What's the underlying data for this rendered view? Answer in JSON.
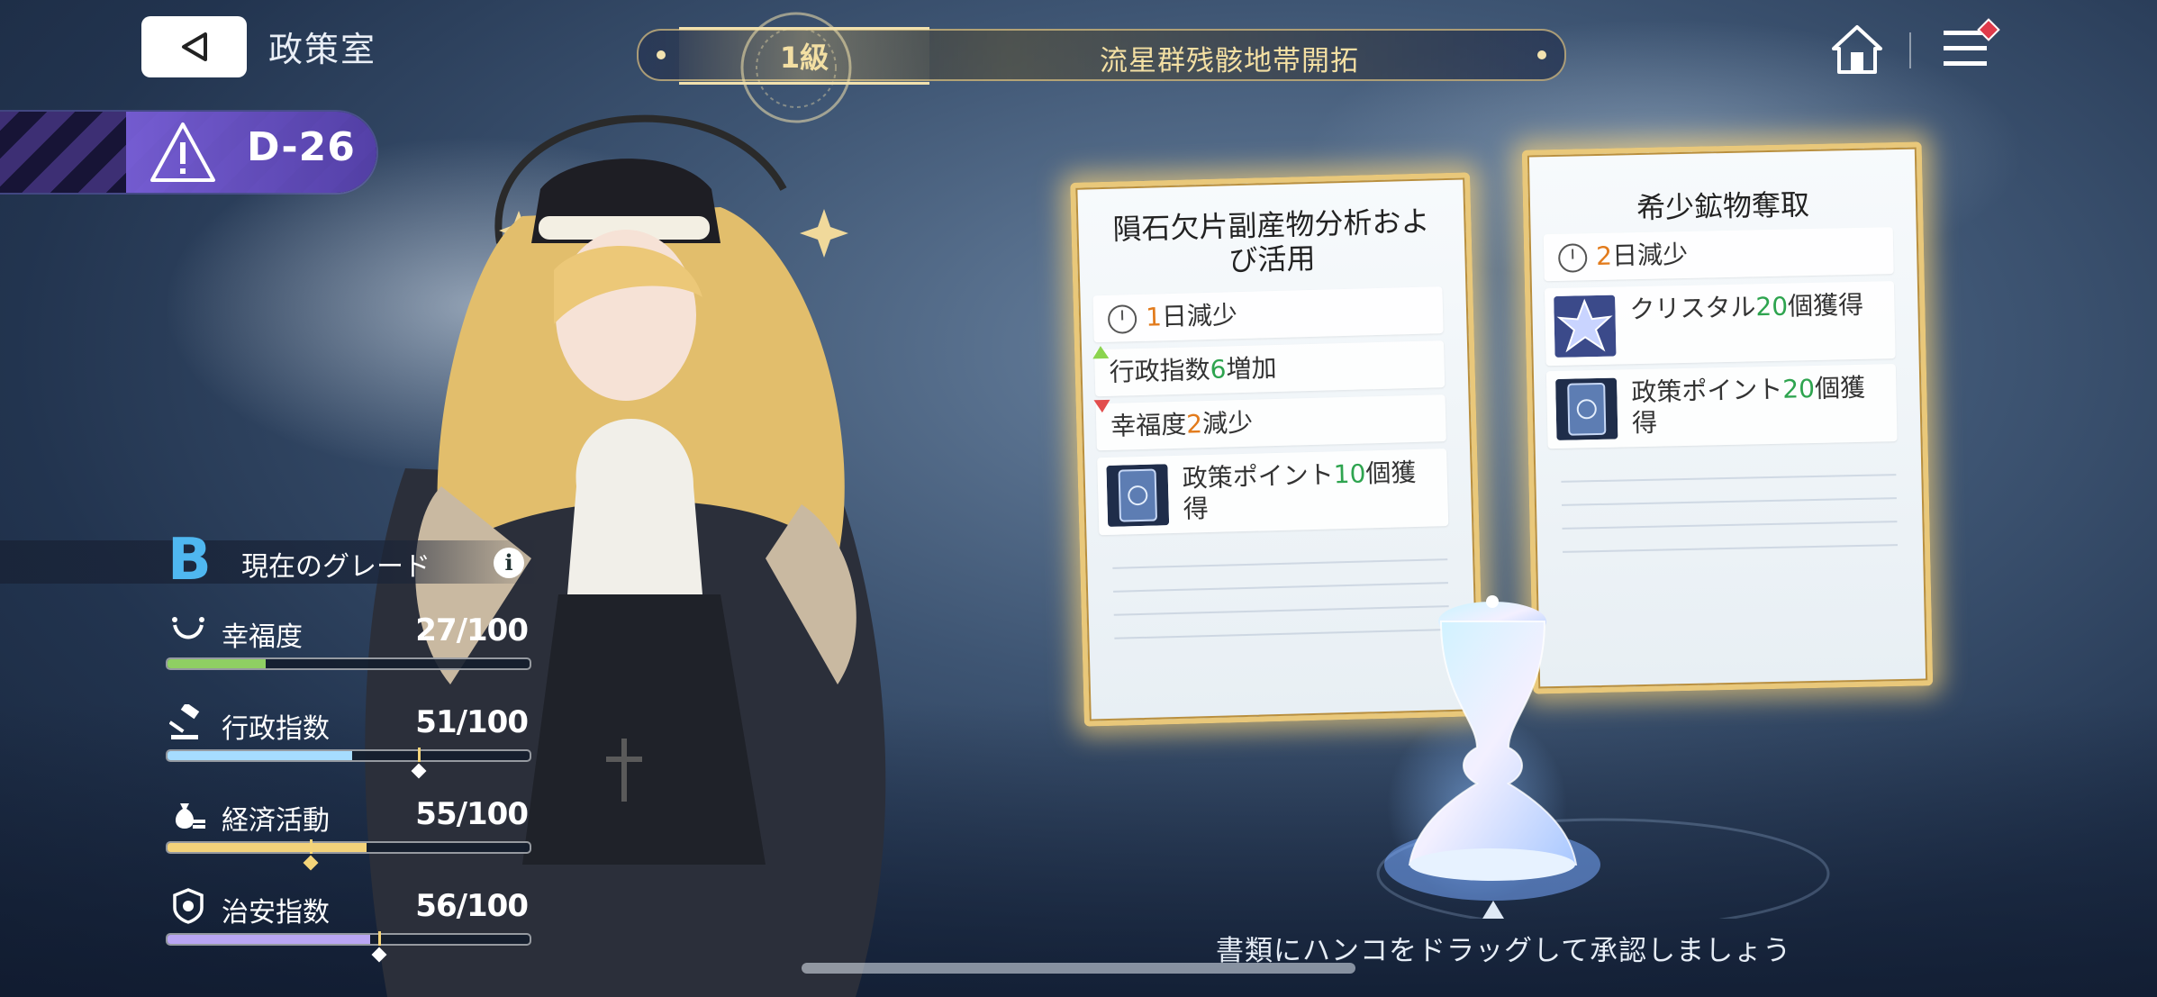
{
  "header": {
    "title": "政策室",
    "banner": {
      "grade": "1級",
      "name": "流星群残骸地帯開拓"
    }
  },
  "difficulty": {
    "label": "D-26",
    "color": "#7a5fd6"
  },
  "grade": {
    "letter": "B",
    "label": "現在のグレード",
    "info": "i"
  },
  "stats": [
    {
      "label": "幸福度",
      "value": "27/100",
      "current": 27,
      "color": "#8fcf63",
      "icon": "smile-icon"
    },
    {
      "label": "行政指数",
      "value": "51/100",
      "current": 51,
      "target": 70,
      "color": "#a6dcff",
      "icon": "gavel-icon"
    },
    {
      "label": "経済活動",
      "value": "55/100",
      "current": 55,
      "target": 40,
      "color": "#f3d27a",
      "icon": "money-bag-icon"
    },
    {
      "label": "治安指数",
      "value": "56/100",
      "current": 56,
      "target": 59,
      "color": "#b9a6f3",
      "icon": "badge-icon"
    }
  ],
  "cards": [
    {
      "title": "隕石欠片副産物分析および活用",
      "duration": {
        "num": "1",
        "text": "日減少"
      },
      "effects": [
        {
          "prefix": "行政指数",
          "num": "6",
          "suffix": "増加",
          "direction": "up"
        },
        {
          "prefix": "幸福度",
          "num": "2",
          "suffix": "減少",
          "direction": "down"
        }
      ],
      "rewards": [
        {
          "prefix": "政策ポイント",
          "num": "10",
          "suffix": "個獲得",
          "icon": "policy-point-icon"
        }
      ]
    },
    {
      "title": "希少鉱物奪取",
      "duration": {
        "num": "2",
        "text": "日減少"
      },
      "effects": [],
      "rewards": [
        {
          "prefix": "クリスタル",
          "num": "20",
          "suffix": "個獲得",
          "icon": "crystal-icon"
        },
        {
          "prefix": "政策ポイント",
          "num": "20",
          "suffix": "個獲得",
          "icon": "policy-point-icon"
        }
      ]
    }
  ],
  "instruction": "書類にハンコをドラッグして承認しましょう"
}
